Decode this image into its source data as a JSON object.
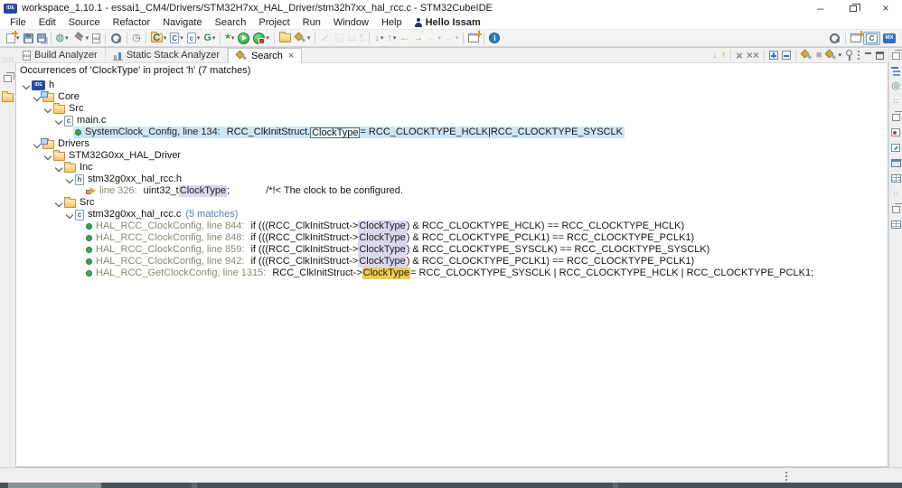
{
  "window": {
    "title": "workspace_1.10.1 - essai1_CM4/Drivers/STM32H7xx_HAL_Driver/stm32h7xx_hal_rcc.c - STM32CubeIDE",
    "app_badge": "IDE",
    "controls": {
      "minimize": "–",
      "close": "×"
    }
  },
  "menu": {
    "items": [
      "File",
      "Edit",
      "Source",
      "Refactor",
      "Navigate",
      "Search",
      "Project",
      "Run",
      "Window",
      "Help"
    ],
    "greeting": "Hello Issam"
  },
  "main_toolbar": {
    "items": [
      {
        "n": "new-wizard",
        "i": "new",
        "caret": true
      },
      {
        "n": "save",
        "i": "save"
      },
      {
        "n": "save-all",
        "i": "saveall"
      },
      {
        "sep": true
      },
      {
        "n": "launch",
        "g": "◍",
        "c": "#46806a",
        "caret": true
      },
      {
        "n": "build",
        "i": "hammer",
        "caret": true
      },
      {
        "n": "build-analyzer",
        "i": "binary",
        "letter": "010"
      },
      {
        "sep": true
      },
      {
        "n": "search-small",
        "i": "mag"
      },
      {
        "sep": true
      },
      {
        "n": "device-configuration",
        "g": "◷",
        "c": "#5c6e7e"
      },
      {
        "sep": true
      },
      {
        "n": "new-c-project",
        "i": "folder",
        "letter": "C",
        "caret": true
      },
      {
        "n": "new-cpp-source",
        "i": "file",
        "letter": "C",
        "caret": true
      },
      {
        "n": "new-c-file",
        "i": "file",
        "letter": "c",
        "caret": true
      },
      {
        "n": "generate-code",
        "g": "G",
        "c": "#2e8b57",
        "bold": true,
        "caret": true
      },
      {
        "sep": true
      },
      {
        "n": "debug-config",
        "g": "*",
        "c": "#4c8f4c",
        "bold": true,
        "fs": 14,
        "caret": true
      },
      {
        "n": "run",
        "i": "run"
      },
      {
        "n": "profile",
        "i": "profile",
        "caret": true
      },
      {
        "sep": true
      },
      {
        "n": "open-folder",
        "i": "folder"
      },
      {
        "n": "search-flashlight",
        "i": "flash",
        "caret": true
      },
      {
        "sep": true
      },
      {
        "n": "format",
        "i": "pencil",
        "dim": true
      },
      {
        "n": "toggle-source-header",
        "g": "◱",
        "c": "#b8b8b8",
        "dim": true
      },
      {
        "n": "mark-occurrences",
        "g": "⊔",
        "c": "#b8b8b8",
        "dim": true
      },
      {
        "n": "show-whitespace",
        "g": "¶",
        "c": "#b0b0b0",
        "dim": true
      },
      {
        "sep": true
      },
      {
        "n": "next-annotation",
        "g": "↓",
        "c": "#8a98a8",
        "caret": true
      },
      {
        "n": "previous-annotation",
        "g": "↑",
        "c": "#8a98a8",
        "caret": true
      },
      {
        "n": "last-edit-back",
        "g": "←",
        "c": "#cf9f3a",
        "bold": true
      },
      {
        "n": "last-edit-forward",
        "g": "→",
        "c": "#cf9f3a",
        "bold": true
      },
      {
        "n": "back-history",
        "g": "←",
        "c": "#b8b8b8",
        "caret": true,
        "dim": true
      },
      {
        "n": "forward-history",
        "g": "→",
        "c": "#b8b8b8",
        "caret": true,
        "dim": true
      },
      {
        "sep": true
      },
      {
        "n": "open-perspective",
        "i": "winplus"
      },
      {
        "sep": true
      },
      {
        "n": "help-info",
        "i": "info",
        "letter": "i"
      }
    ],
    "right_items": [
      {
        "n": "access-search",
        "i": "mag"
      },
      {
        "sep": true
      },
      {
        "n": "open-perspective-right",
        "i": "winplus"
      }
    ]
  },
  "perspective_bar": {
    "cpp_letter": "C",
    "mx_label": "MX"
  },
  "view_tabs": [
    {
      "label": "Build Analyzer",
      "icon": "binary",
      "letter": "010"
    },
    {
      "label": "Static Stack Analyzer",
      "icon": "stack"
    },
    {
      "label": "Search",
      "icon": "flash",
      "active": true,
      "closable": true,
      "close_glyph": "×"
    }
  ],
  "search_toolbar": {
    "items": [
      {
        "n": "next-match",
        "g": "↓",
        "c": "#d8a53c",
        "bold": true
      },
      {
        "n": "previous-match",
        "g": "↑",
        "c": "#d8a53c",
        "bold": true
      },
      {
        "sep": true
      },
      {
        "n": "remove-match",
        "g": "×",
        "c": "#8a8a8a",
        "bold": true,
        "fs": 13
      },
      {
        "n": "remove-all-matches",
        "g": "××",
        "c": "#8a8a8a",
        "bold": true,
        "fs": 12
      },
      {
        "sep": true
      },
      {
        "n": "expand-all",
        "i": "expand"
      },
      {
        "n": "collapse-all",
        "i": "collapse"
      },
      {
        "sep": true
      },
      {
        "n": "run-search-again",
        "i": "flash"
      },
      {
        "n": "terminate-search",
        "g": "■",
        "c": "#b0b0b0"
      },
      {
        "n": "previous-searches",
        "i": "flash",
        "caret": true
      },
      {
        "n": "pin-view",
        "i": "pin"
      },
      {
        "n": "view-menu",
        "i": "vdots"
      },
      {
        "n": "minimize-view",
        "i": "min"
      },
      {
        "n": "maximize-view",
        "i": "max"
      }
    ]
  },
  "left_trim": {
    "items": [
      {
        "n": "trim-handle",
        "i": "handle"
      },
      {
        "n": "restore-editor",
        "i": "win"
      },
      {
        "n": "search-history",
        "i": "folder"
      }
    ]
  },
  "right_strip": {
    "items": [
      {
        "n": "restore-outline-stack",
        "i": "win"
      },
      {
        "n": "outline-view",
        "i": "outline"
      },
      {
        "n": "build-targets-view",
        "g": "◎",
        "c": "#2e8b57"
      },
      {
        "n": "trim-dots-1",
        "i": "dots4"
      },
      {
        "n": "restore-debug-stack",
        "i": "win"
      },
      {
        "n": "breakpoints-view",
        "i": "winred"
      },
      {
        "n": "expressions-view",
        "i": "wincheck"
      },
      {
        "n": "console-view",
        "i": "console"
      },
      {
        "n": "properties-view",
        "i": "table"
      },
      {
        "n": "trim-dots-2",
        "i": "dots4"
      },
      {
        "n": "restore-misc-stack",
        "i": "win"
      },
      {
        "n": "registers-view",
        "i": "table"
      }
    ]
  },
  "search": {
    "header": "Occurrences of 'ClockType' in project 'h' (7 matches)",
    "tree": [
      {
        "level": 0,
        "icon": "proj",
        "letter": "IDE",
        "label": "h",
        "expanded": true
      },
      {
        "level": 1,
        "icon": "folder-mod",
        "label": "Core",
        "expanded": true
      },
      {
        "level": 2,
        "icon": "folder",
        "label": "Src",
        "expanded": true
      },
      {
        "level": 3,
        "icon": "file",
        "letter": "c",
        "label": "main.c",
        "expanded": true
      },
      {
        "level": 4,
        "icon": "dot",
        "prefix": "SystemClock_Config, line 134:",
        "before": "RCC_ClkInitStruct.",
        "match": "ClockType",
        "after": " = RCC_CLOCKTYPE_HCLK|RCC_CLOCKTYPE_SYSCLK",
        "state": "selected"
      },
      {
        "level": 1,
        "icon": "folder-mod",
        "label": "Drivers",
        "expanded": true
      },
      {
        "level": 2,
        "icon": "folder",
        "label": "STM32G0xx_HAL_Driver",
        "expanded": true
      },
      {
        "level": 3,
        "icon": "folder",
        "label": "Inc",
        "expanded": true
      },
      {
        "level": 4,
        "icon": "file",
        "letter": "h",
        "label": "stm32g0xx_hal_rcc.h",
        "expanded": true
      },
      {
        "level": 5,
        "icon": "arrow",
        "prefix": "line 326:",
        "before": "uint32_t ",
        "match": "ClockType",
        "after": ";",
        "comment": "/*!< The clock to be configured.",
        "state": "read"
      },
      {
        "level": 3,
        "icon": "folder",
        "label": "Src",
        "expanded": true
      },
      {
        "level": 4,
        "icon": "file",
        "letter": "c",
        "label": "stm32g0xx_hal_rcc.c",
        "count": "(5 matches)",
        "expanded": true
      },
      {
        "level": 5,
        "icon": "dot",
        "prefix": "HAL_RCC_ClockConfig, line 844:",
        "before": "if (((RCC_ClkInitStruct->",
        "match": "ClockType",
        "after": ") & RCC_CLOCKTYPE_HCLK) == RCC_CLOCKTYPE_HCLK)",
        "state": "read"
      },
      {
        "level": 5,
        "icon": "dot",
        "prefix": "HAL_RCC_ClockConfig, line 848:",
        "before": "if (((RCC_ClkInitStruct->",
        "match": "ClockType",
        "after": ") & RCC_CLOCKTYPE_PCLK1) == RCC_CLOCKTYPE_PCLK1)",
        "state": "read"
      },
      {
        "level": 5,
        "icon": "dot",
        "prefix": "HAL_RCC_ClockConfig, line 859:",
        "before": "if (((RCC_ClkInitStruct->",
        "match": "ClockType",
        "after": ") & RCC_CLOCKTYPE_SYSCLK) == RCC_CLOCKTYPE_SYSCLK)",
        "state": "read"
      },
      {
        "level": 5,
        "icon": "dot",
        "prefix": "HAL_RCC_ClockConfig, line 942:",
        "before": "if (((RCC_ClkInitStruct->",
        "match": "ClockType",
        "after": ") & RCC_CLOCKTYPE_PCLK1) == RCC_CLOCKTYPE_PCLK1)",
        "state": "read"
      },
      {
        "level": 5,
        "icon": "dot",
        "prefix": "HAL_RCC_GetClockConfig, line 1315:",
        "before": "RCC_ClkInitStruct->",
        "match": "ClockType",
        "after": " = RCC_CLOCKTYPE_SYSCLK | RCC_CLOCKTYPE_HCLK | RCC_CLOCKTYPE_PCLK1;",
        "state": "write"
      }
    ]
  },
  "colors": {
    "selection": "#cde6f7",
    "match_highlight": "#d9d8ef",
    "write_match_highlight": "#f0cd4e",
    "match_count": "#527dac",
    "prefix_gray": "#8a8772",
    "accent_blue": "#2f6fbe",
    "taskbar": "#47525a"
  }
}
